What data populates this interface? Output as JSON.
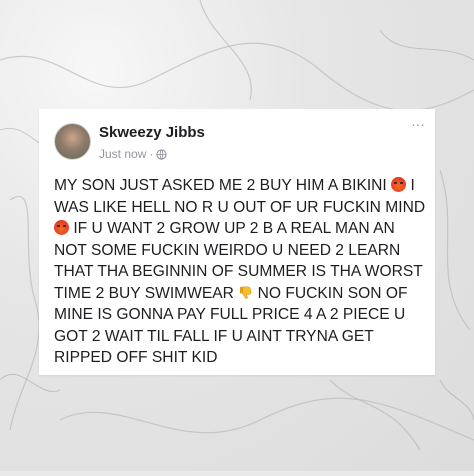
{
  "post": {
    "author": "Skweezy Jibbs",
    "timestamp": "Just now",
    "separator": "·",
    "more_icon": "···",
    "lines": [
      [
        "MY SON JUST ASKED ME 2 BUY HIM A BIKINI",
        "I"
      ],
      [
        "WAS LIKE HELL NO R U OUT OF UR FUCKIN MIND"
      ],
      [
        "IF U WANT 2 GROW UP 2 B A REAL MAN AN"
      ],
      [
        "NOT SOME FUCKIN WEIRDO U NEED 2 LEARN"
      ],
      [
        "THAT THA BEGINNIN OF SUMMER IS THA WORST"
      ],
      [
        "TIME 2 BUY SWIMWEAR",
        "NO FUCKIN SON OF"
      ],
      [
        "MINE IS GONNA PAY FULL PRICE 4 A 2 PIECE U"
      ],
      [
        "GOT 2 WAIT TIL FALL IF U AINT TRYNA GET"
      ],
      [
        "RIPPED OFF SHIT KID"
      ]
    ],
    "emoji": {
      "angry": "angry-face-emoji",
      "thumbs_down": "thumbs-down-emoji"
    }
  },
  "colors": {
    "card_background": "#ffffff",
    "text": "#1c1e21",
    "meta": "#90949c"
  }
}
